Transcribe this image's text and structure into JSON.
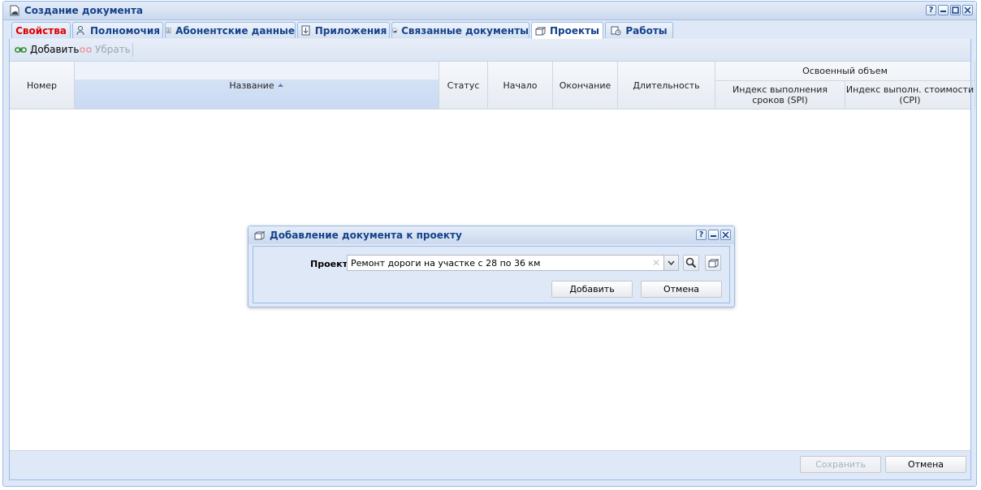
{
  "window": {
    "title": "Создание документа",
    "title_icon": "document-icon",
    "tool_help": "?",
    "tool_min": "–",
    "tool_max": "□",
    "tool_close": "×"
  },
  "tabs": [
    {
      "label": "Свойства",
      "icon": "",
      "active": false,
      "color": "#e00000"
    },
    {
      "label": "Полномочия",
      "icon": "user-key-icon",
      "active": false
    },
    {
      "label": "Абонентские данные",
      "icon": "contact-card-icon",
      "active": false
    },
    {
      "label": "Приложения",
      "icon": "attachment-download-icon",
      "active": false
    },
    {
      "label": "Связанные документы",
      "icon": "linked-document-icon",
      "active": false
    },
    {
      "label": "Проекты",
      "icon": "project-box-icon",
      "active": true
    },
    {
      "label": "Работы",
      "icon": "tasks-clock-icon",
      "active": false
    }
  ],
  "toolbar": {
    "add_label": "Добавить",
    "remove_label": "Убрать"
  },
  "grid": {
    "columns": {
      "number": "Номер",
      "name": "Название",
      "status": "Статус",
      "start": "Начало",
      "end": "Окончание",
      "duration": "Длительность",
      "earned_group": "Освоенный объем",
      "spi": "Индекс выполнения сроков (SPI)",
      "cpi": "Индекс выполн. стоимости (CPI)"
    },
    "sort": {
      "column": "name",
      "direction": "ascending"
    },
    "rows": []
  },
  "footer": {
    "save_label": "Сохранить",
    "cancel_label": "Отмена"
  },
  "dialog": {
    "title": "Добавление документа к проекту",
    "field_label": "Проект:",
    "project_value": "Ремонт дороги на участке с 28 по 36 км",
    "add_label": "Добавить",
    "cancel_label": "Отмена"
  },
  "colors": {
    "accent": "#15428b",
    "border": "#99bbe8",
    "background": "#dfe8f6",
    "required_tab": "#e00000"
  }
}
